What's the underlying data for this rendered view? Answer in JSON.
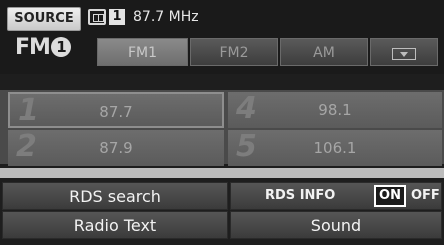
{
  "header": {
    "source_label": "SOURCE",
    "band_badge": {
      "letters": "FM",
      "number": "1"
    },
    "stereo_icon": "stereo-indicator-icon",
    "preset_number": "1",
    "current_frequency": "87.7 MHz"
  },
  "tabs": [
    {
      "label": "FM1",
      "active": true
    },
    {
      "label": "FM2",
      "active": false
    },
    {
      "label": "AM",
      "active": false
    },
    {
      "label": "",
      "icon": "tuner-list-arrow-icon",
      "active": false
    }
  ],
  "presets": [
    {
      "number": "1",
      "frequency": "87.7",
      "selected": true
    },
    {
      "number": "4",
      "frequency": "98.1",
      "selected": false
    },
    {
      "number": "2",
      "frequency": "87.9",
      "selected": false
    },
    {
      "number": "5",
      "frequency": "106.1",
      "selected": false
    }
  ],
  "menu": {
    "rds_search": "RDS search",
    "radio_text": "Radio Text",
    "sound": "Sound",
    "rds_info": {
      "label": "RDS INFO",
      "on": "ON",
      "off": "OFF",
      "state": "ON"
    }
  }
}
